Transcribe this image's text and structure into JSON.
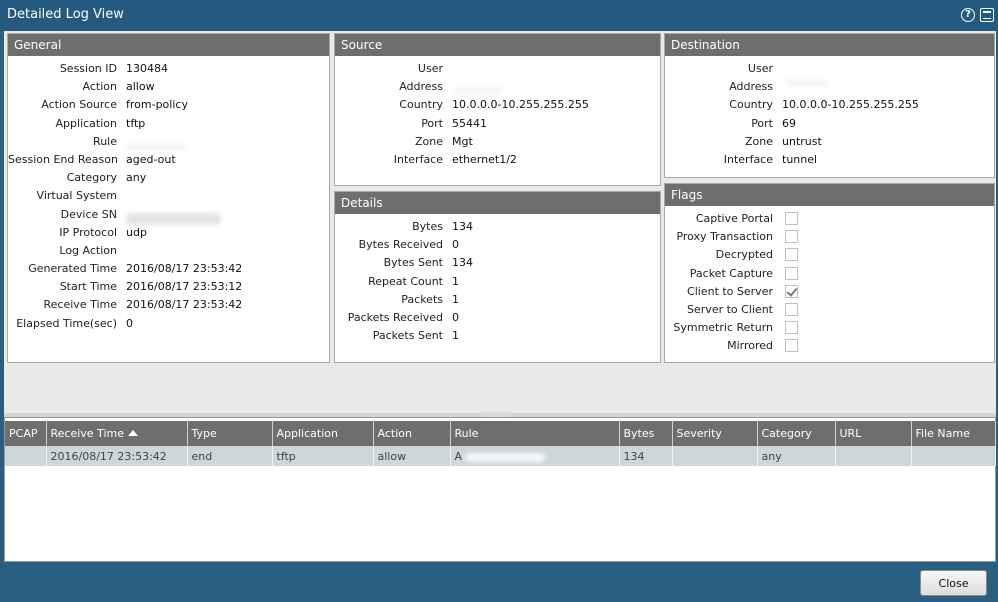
{
  "window": {
    "title": "Detailed Log View",
    "help_icon": "help-circle-icon",
    "maximize_icon": "window-maximize-icon"
  },
  "general": {
    "heading": "General",
    "fields": [
      {
        "label": "Session ID",
        "value": "130484"
      },
      {
        "label": "Action",
        "value": "allow"
      },
      {
        "label": "Action Source",
        "value": "from-policy"
      },
      {
        "label": "Application",
        "value": "tftp"
      },
      {
        "label": "Rule",
        "value": ""
      },
      {
        "label": "Session End Reason",
        "value": "aged-out"
      },
      {
        "label": "Category",
        "value": "any"
      },
      {
        "label": "Virtual System",
        "value": ""
      },
      {
        "label": "Device SN",
        "value": ""
      },
      {
        "label": "IP Protocol",
        "value": "udp"
      },
      {
        "label": "Log Action",
        "value": ""
      },
      {
        "label": "Generated Time",
        "value": "2016/08/17 23:53:42"
      },
      {
        "label": "Start Time",
        "value": "2016/08/17 23:53:12"
      },
      {
        "label": "Receive Time",
        "value": "2016/08/17 23:53:42"
      },
      {
        "label": "Elapsed Time(sec)",
        "value": "0"
      }
    ]
  },
  "source": {
    "heading": "Source",
    "fields": [
      {
        "label": "User",
        "value": ""
      },
      {
        "label": "Address",
        "value": ""
      },
      {
        "label": "Country",
        "value": "10.0.0.0-10.255.255.255"
      },
      {
        "label": "Port",
        "value": "55441"
      },
      {
        "label": "Zone",
        "value": "Mgt"
      },
      {
        "label": "Interface",
        "value": "ethernet1/2"
      }
    ]
  },
  "destination": {
    "heading": "Destination",
    "fields": [
      {
        "label": "User",
        "value": ""
      },
      {
        "label": "Address",
        "value": ""
      },
      {
        "label": "Country",
        "value": "10.0.0.0-10.255.255.255"
      },
      {
        "label": "Port",
        "value": "69"
      },
      {
        "label": "Zone",
        "value": "untrust"
      },
      {
        "label": "Interface",
        "value": "tunnel"
      }
    ]
  },
  "details": {
    "heading": "Details",
    "fields": [
      {
        "label": "Bytes",
        "value": "134"
      },
      {
        "label": "Bytes Received",
        "value": "0"
      },
      {
        "label": "Bytes Sent",
        "value": "134"
      },
      {
        "label": "Repeat Count",
        "value": "1"
      },
      {
        "label": "Packets",
        "value": "1"
      },
      {
        "label": "Packets Received",
        "value": "0"
      },
      {
        "label": "Packets Sent",
        "value": "1"
      }
    ]
  },
  "flags": {
    "heading": "Flags",
    "items": [
      {
        "label": "Captive Portal",
        "checked": false
      },
      {
        "label": "Proxy Transaction",
        "checked": false
      },
      {
        "label": "Decrypted",
        "checked": false
      },
      {
        "label": "Packet Capture",
        "checked": false
      },
      {
        "label": "Client to Server",
        "checked": true
      },
      {
        "label": "Server to Client",
        "checked": false
      },
      {
        "label": "Symmetric Return",
        "checked": false
      },
      {
        "label": "Mirrored",
        "checked": false
      }
    ]
  },
  "table": {
    "columns": [
      "PCAP",
      "Receive Time",
      "Type",
      "Application",
      "Action",
      "Rule",
      "Bytes",
      "Severity",
      "Category",
      "URL",
      "File Name"
    ],
    "sorted_column": "Receive Time",
    "sort_icon": "sort-ascending-icon",
    "rows": [
      [
        "",
        "2016/08/17 23:53:42",
        "end",
        "tftp",
        "allow",
        "A",
        "134",
        "",
        "any",
        "",
        ""
      ]
    ]
  },
  "footer": {
    "close_label": "Close"
  }
}
